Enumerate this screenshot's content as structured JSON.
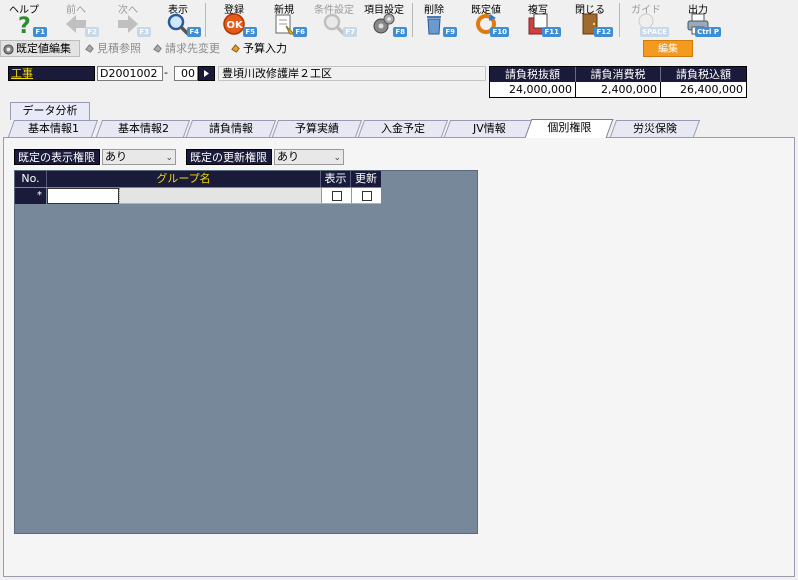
{
  "toolbar": {
    "help": {
      "label": "ヘルプ",
      "key": "F1"
    },
    "prev": {
      "label": "前へ",
      "key": "F2"
    },
    "next": {
      "label": "次へ",
      "key": "F3"
    },
    "display": {
      "label": "表示",
      "key": "F4"
    },
    "register": {
      "label": "登録",
      "key": "F5"
    },
    "new": {
      "label": "新規",
      "key": "F6"
    },
    "conditions": {
      "label": "条件設定",
      "key": "F7"
    },
    "items": {
      "label": "項目設定",
      "key": "F8"
    },
    "delete": {
      "label": "削除",
      "key": "F9"
    },
    "default": {
      "label": "既定値",
      "key": "F10"
    },
    "copy": {
      "label": "複写",
      "key": "F11"
    },
    "close": {
      "label": "閉じる",
      "key": "F12"
    },
    "guide": {
      "label": "ガイド",
      "key": "SPACE"
    },
    "output": {
      "label": "出力",
      "key": "Ctrl P"
    }
  },
  "modes": {
    "default_edit": "既定値編集",
    "estimate_ref": "見積参照",
    "billing_change": "請求先変更",
    "budget_input": "予算入力"
  },
  "edit_button": "編集",
  "project": {
    "label": "工事",
    "code": "D2001002",
    "dash": "-",
    "branch": "00",
    "name": "豊頃川改修護岸２工区"
  },
  "totals": {
    "headers": [
      "請負税抜額",
      "請負消費税",
      "請負税込額"
    ],
    "values": [
      "24,000,000",
      "2,400,000",
      "26,400,000"
    ]
  },
  "analysis_tab": "データ分析",
  "tabs": [
    "基本情報1",
    "基本情報2",
    "請負情報",
    "予算実績",
    "入金予定",
    "JV情報",
    "個別権限",
    "労災保険"
  ],
  "active_tab": "個別権限",
  "permissions": {
    "display_label": "既定の表示権限",
    "display_value": "あり",
    "update_label": "既定の更新権限",
    "update_value": "あり"
  },
  "grid": {
    "headers": {
      "no": "No.",
      "group": "グループ名",
      "show": "表示",
      "update": "更新"
    },
    "new_row_marker": "*"
  },
  "colors": {
    "header_bg": "#1a1a3a",
    "accent_yellow": "#f0d800",
    "grid_bg": "#76889a",
    "edit_orange": "#f39a1f"
  }
}
